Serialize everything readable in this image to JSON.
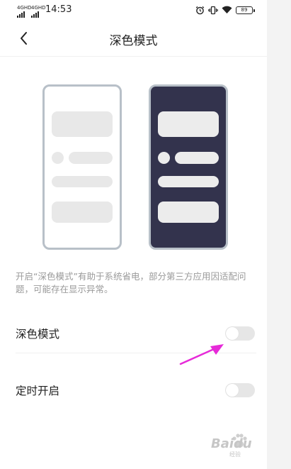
{
  "status_bar": {
    "signal_1": "4GHD",
    "signal_2": "4GHD",
    "time": "14:53",
    "icons": [
      "alarm-icon",
      "vibrate-icon",
      "wifi-icon",
      "battery-icon"
    ],
    "battery_level": "89"
  },
  "header": {
    "title": "深色模式",
    "back_icon": "chevron-left-icon"
  },
  "illustration": {
    "light_phone_color": "#ffffff",
    "dark_phone_color": "#33334d"
  },
  "description": "开启“深色模式”有助于系统省电，部分第三方应用因适配问题，可能存在显示异常。",
  "settings": [
    {
      "label": "深色模式",
      "enabled": false
    },
    {
      "label": "定时开启",
      "enabled": false
    }
  ],
  "annotation": {
    "arrow_color": "#e62ad8"
  },
  "watermark": {
    "text": "Baidu",
    "sub": "经验"
  }
}
